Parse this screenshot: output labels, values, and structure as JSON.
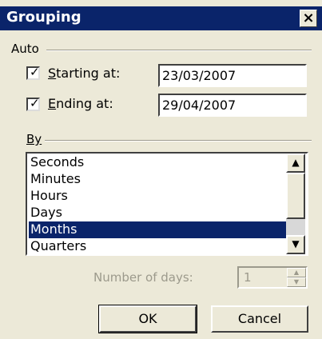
{
  "window": {
    "title": "Grouping",
    "close_label": "×"
  },
  "auto": {
    "section_label": "Auto",
    "starting": {
      "label": "Starting at:",
      "checked": true,
      "value": "23/03/2007"
    },
    "ending": {
      "label": "Ending at:",
      "checked": true,
      "value": "29/04/2007"
    }
  },
  "by": {
    "section_label": "By",
    "items": [
      "Seconds",
      "Minutes",
      "Hours",
      "Days",
      "Months",
      "Quarters"
    ],
    "selected": "Months"
  },
  "number_of_days": {
    "label": "Number of days:",
    "value": "1",
    "enabled": false
  },
  "buttons": {
    "ok_label": "OK",
    "cancel_label": "Cancel"
  },
  "colors": {
    "selection": "#0A246A",
    "dialog_bg": "#ECE9D8"
  }
}
